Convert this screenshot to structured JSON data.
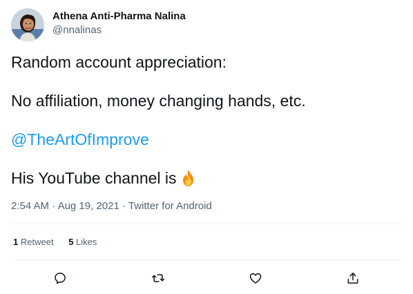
{
  "author": {
    "display_name": "Athena Anti-Pharma Nalina",
    "handle": "@nnalinas"
  },
  "tweet": {
    "line1": "Random account appreciation:",
    "line2": "No affiliation, money changing hands, etc.",
    "mention": "@TheArtOfImprove",
    "line4": "His YouTube channel is",
    "emoji": "fire-icon"
  },
  "meta": {
    "time": "2:54 AM",
    "separator1": " · ",
    "date": "Aug 19, 2021",
    "separator2": " · ",
    "source": "Twitter for Android"
  },
  "stats": {
    "retweets_count": "1",
    "retweets_label": "Retweet",
    "likes_count": "5",
    "likes_label": "Likes"
  },
  "colors": {
    "link": "#1d9bf0",
    "secondary_text": "#536471",
    "primary_text": "#0f1419",
    "divider": "#eff3f4"
  }
}
